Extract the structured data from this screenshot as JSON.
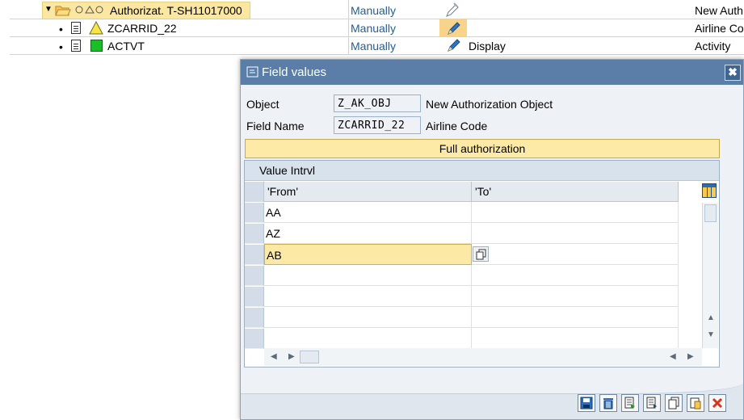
{
  "tree": {
    "rows": [
      {
        "node": "Authorizat. T-SH11017000",
        "status": "Manually",
        "right": "New Auth"
      },
      {
        "node": "ZCARRID_22",
        "status": "Manually",
        "right": "Airline Coc"
      },
      {
        "node": "ACTVT",
        "status": "Manually",
        "display": "Display",
        "right": "Activity"
      }
    ],
    "bullet": "•"
  },
  "dialog": {
    "title": "Field values",
    "close_glyph": "✖",
    "object_label": "Object",
    "object_value": "Z_AK_OBJ",
    "object_desc": "New Authorization Object",
    "field_label": "Field Name",
    "field_value": "ZCARRID_22",
    "field_desc": "Airline Code",
    "full_auth_label": "Full authorization",
    "table": {
      "title": "Value Intrvl",
      "col_from": "'From'",
      "col_to": "'To'",
      "rows": [
        {
          "from": "AA",
          "to": ""
        },
        {
          "from": "AZ",
          "to": ""
        },
        {
          "from": "AB",
          "to": ""
        },
        {
          "from": "",
          "to": ""
        },
        {
          "from": "",
          "to": ""
        },
        {
          "from": "",
          "to": ""
        },
        {
          "from": "",
          "to": ""
        }
      ]
    },
    "scroll": {
      "up": "▲",
      "down": "▼",
      "left": "◀",
      "right": "▶",
      "grip": "⠿"
    }
  },
  "colors": {
    "accent": "#5a7ea7",
    "highlight": "#fde9a6",
    "link": "#1f5f9c"
  }
}
